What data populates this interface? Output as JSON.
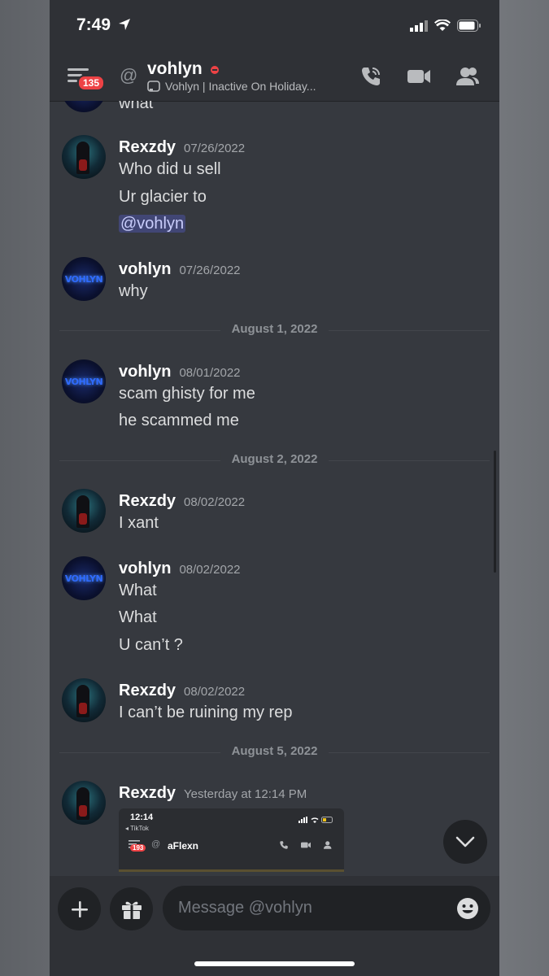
{
  "status_bar": {
    "time": "7:49"
  },
  "header": {
    "badge": "135",
    "channel_name": "vohlyn",
    "status_text": "Vohlyn | Inactive On Holiday..."
  },
  "messages": [
    {
      "author": "",
      "lines": [
        "what"
      ]
    },
    {
      "author": "Rexzdy",
      "timestamp": "07/26/2022",
      "avatar": "Rexzdy",
      "lines": [
        "Who did u sell",
        "Ur glacier to"
      ],
      "mention": "@vohlyn"
    },
    {
      "author": "vohlyn",
      "timestamp": "07/26/2022",
      "avatar": "VOHLYN",
      "lines": [
        "why"
      ]
    },
    {
      "author": "vohlyn",
      "timestamp": "08/01/2022",
      "avatar": "VOHLYN",
      "lines": [
        "scam ghisty for me",
        "he scammed me"
      ]
    },
    {
      "author": "Rexzdy",
      "timestamp": "08/02/2022",
      "avatar": "Rexzdy",
      "lines": [
        "I xant"
      ]
    },
    {
      "author": "vohlyn",
      "timestamp": "08/02/2022",
      "avatar": "VOHLYN",
      "lines": [
        "What",
        "What",
        "U can’t ?"
      ]
    },
    {
      "author": "Rexzdy",
      "timestamp": "08/02/2022",
      "avatar": "Rexzdy",
      "lines": [
        "I can’t be ruining my rep"
      ]
    },
    {
      "author": "Rexzdy",
      "timestamp": "Yesterday at 12:14 PM",
      "avatar": "Rexzdy",
      "lines": []
    }
  ],
  "dividers": [
    "August 1, 2022",
    "August 2, 2022",
    "August 5, 2022"
  ],
  "attachment": {
    "time": "12:14",
    "back_label": "◂ TikTok",
    "badge": "193",
    "name": "aFlexn"
  },
  "composer": {
    "placeholder": "Message @vohlyn"
  },
  "colors": {
    "background": "#36393f",
    "header": "#2f3136",
    "input": "#202225",
    "badge": "#ed4245",
    "mention_bg": "#414675"
  }
}
